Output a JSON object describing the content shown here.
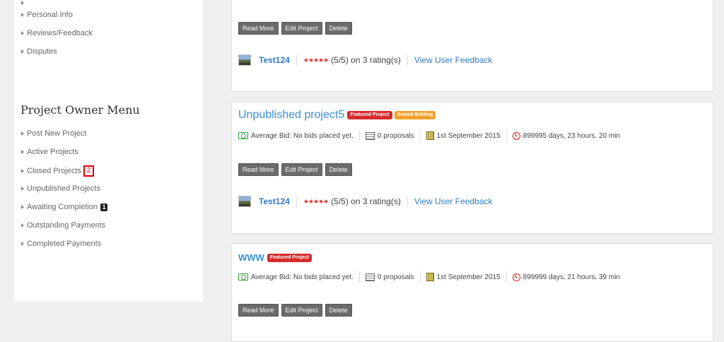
{
  "sidebar": {
    "top_items": [
      "Personal Info",
      "Reviews/Feedback",
      "Disputes"
    ],
    "owner_menu_title": "Project Owner Menu",
    "owner_items": [
      "Post New Project",
      "Active Projects",
      "Closed Projects",
      "Unpublished Projects",
      "Awaiting Completion",
      "Outstanding Payments",
      "Completed Payments"
    ],
    "closed_projects_marker": "2",
    "awaiting_completion_count": "1"
  },
  "buttons": {
    "read_more": "Read More",
    "edit_project": "Edit Project",
    "delete": "Delete"
  },
  "owner": {
    "username": "Test124",
    "stars": "★★★★★",
    "rating": "(5/5) on 3 rating(s)",
    "view_feedback": "View User Feedback"
  },
  "projects": [
    {
      "title": "Unpublished project5",
      "tags": [
        "Featured Project",
        "Sealed Bidding"
      ],
      "avg_bid": "Average Bid: No bids placed yet.",
      "proposals": "0 proposals",
      "date": "1st September 2015",
      "time_left": "899995 days, 23 hours, 20 min"
    },
    {
      "title": "WWW",
      "tags": [
        "Featured Project"
      ],
      "avg_bid": "Average Bid: No bids placed yet.",
      "proposals": "0 proposals",
      "date": "1st September 2015",
      "time_left": "899999 days, 21 hours, 39 min"
    }
  ],
  "colors": {
    "link_blue": "#3a8fd4",
    "featured_red": "#d62b2b",
    "sealed_orange": "#f2a128",
    "button_gray": "#6b6b6b"
  }
}
